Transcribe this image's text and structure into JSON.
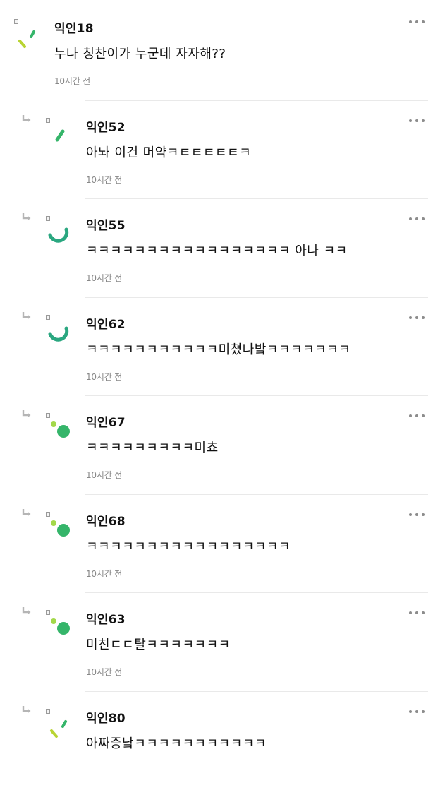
{
  "comments": [
    {
      "author": "익인18",
      "text": "누나 칭찬이가 누군데 자자해??",
      "time": "10시간 전",
      "reply": false,
      "avatar": "stripes-lime"
    },
    {
      "author": "익인52",
      "text": "아놔 이건 머약ㅋㅌㅌㅌㅌㅌㅋ",
      "time": "10시간 전",
      "reply": true,
      "avatar": "dash-green"
    },
    {
      "author": "익인55",
      "text": "ㅋㅋㅋㅋㅋㅋㅋㅋㅋㅋㅋㅋㅋㅋㅋㅋㅋ 아나 ㅋㅋ",
      "time": "10시간 전",
      "reply": true,
      "avatar": "arc-teal"
    },
    {
      "author": "익인62",
      "text": "ㅋㅋㅋㅋㅋㅋㅋㅋㅋㅋㅋ미쳤나밬ㅋㅋㅋㅋㅋㅋㅋ",
      "time": "10시간 전",
      "reply": true,
      "avatar": "arc-teal"
    },
    {
      "author": "익인67",
      "text": "ㅋㅋㅋㅋㅋㅋㅋㅋㅋ미쵸",
      "time": "10시간 전",
      "reply": true,
      "avatar": "dots-green"
    },
    {
      "author": "익인68",
      "text": "ㅋㅋㅋㅋㅋㅋㅋㅋㅋㅋㅋㅋㅋㅋㅋㅋㅋ",
      "time": "10시간 전",
      "reply": true,
      "avatar": "dots-green"
    },
    {
      "author": "익인63",
      "text": "미친ㄷㄷ탈ㅋㅋㅋㅋㅋㅋㅋ",
      "time": "10시간 전",
      "reply": true,
      "avatar": "dots-green"
    },
    {
      "author": "익인80",
      "text": "아짜증낰ㅋㅋㅋㅋㅋㅋㅋㅋㅋㅋㅋ",
      "time": "",
      "reply": true,
      "avatar": "stripes-lime"
    }
  ],
  "colors": {
    "lime": "#b8d432",
    "green": "#35b56a",
    "teal": "#2aa780",
    "light_green": "#a3d84a",
    "time": "#888888"
  },
  "icons": {
    "reply": "reply-arrow-icon",
    "more": "more-options-icon",
    "badge": "user-badge-icon"
  }
}
